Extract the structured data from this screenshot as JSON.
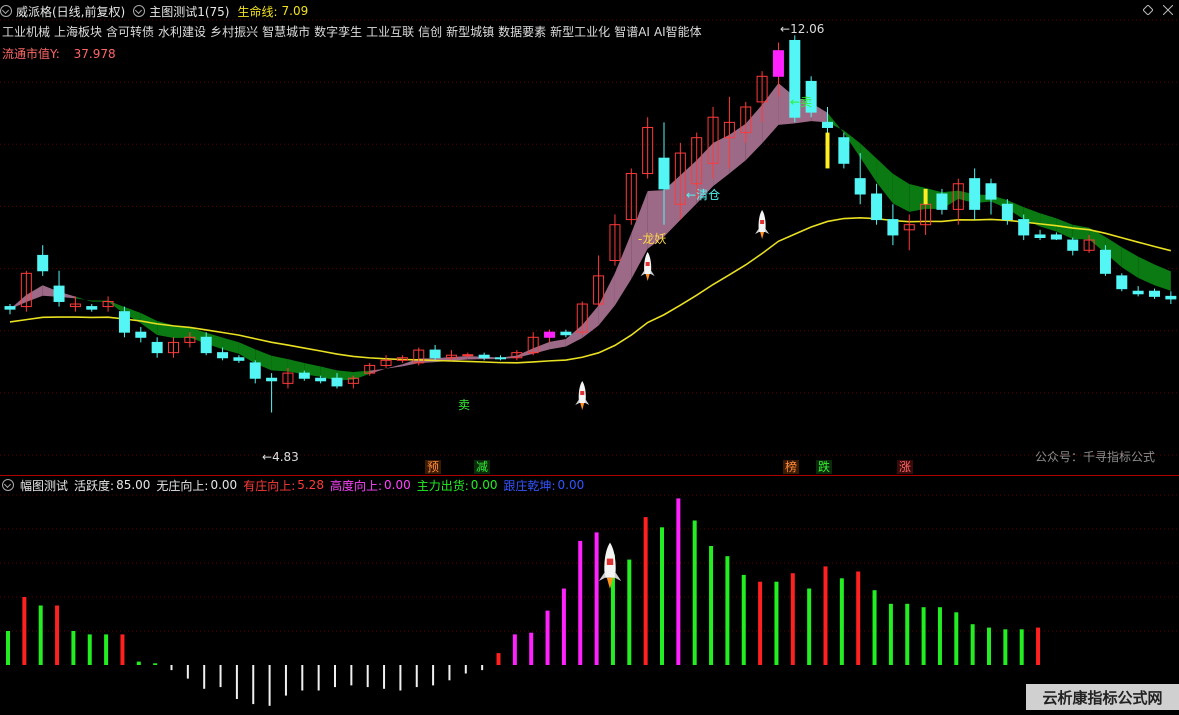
{
  "header": {
    "stock_name": "威派格(日线,前复权)",
    "indicator_name": "主图测试1(75)",
    "lifeline_label": "生命线:",
    "lifeline_value": "7.09"
  },
  "sectors": [
    "工业机械",
    "上海板块",
    "含可转债",
    "水利建设",
    "乡村振兴",
    "智慧城市",
    "数字孪生",
    "工业互联",
    "信创",
    "新型城镇",
    "数据要素",
    "新型工业化",
    "智谱AI",
    "AI智能体"
  ],
  "circulation": {
    "label": "流通市值Y:",
    "value": "37.978"
  },
  "annotations": {
    "high_price": "12.06",
    "low_price": "4.83",
    "sell_top": "卖",
    "sell_mid": "卖",
    "dragon": "龙妖",
    "clear": "清仓",
    "watermark": "公众号：千寻指标公式"
  },
  "signals": [
    {
      "label": "预",
      "color": "#ff8c3a",
      "bg": "#3a1a00"
    },
    {
      "label": "减",
      "color": "#33ee33",
      "bg": "#0a2a0a"
    },
    {
      "label": "榜",
      "color": "#ff8c3a",
      "bg": "#3a1a00"
    },
    {
      "label": "跌",
      "color": "#33ee33",
      "bg": "#0a2a0a"
    },
    {
      "label": "涨",
      "color": "#ff6666",
      "bg": "#3a0a0a"
    }
  ],
  "sub_header": {
    "title": "幅图测试",
    "activity_label": "活跃度:",
    "activity_value": "85.00",
    "no_dealer_label": "无庄向上:",
    "no_dealer_value": "0.00",
    "dealer_label": "有庄向上:",
    "dealer_value": "5.28",
    "control_label": "高度向上:",
    "control_value": "0.00",
    "main_ship_label": "主力出货:",
    "main_ship_value": "0.00",
    "follow_label": "跟庄乾坤:",
    "follow_value": "0.00"
  },
  "footer_brand": "云析康指标公式网",
  "colors": {
    "up": "#ff3a3a",
    "down": "#54f5f5",
    "ma_band_up": "#9c6a86",
    "ma_band_down": "#0c7a12",
    "lifeline": "#e8e020",
    "magenta": "#ff22ff",
    "green_bar": "#22ee22"
  },
  "chart_data": {
    "type": "candlestick",
    "ylim": [
      4.0,
      12.5
    ],
    "candles": [
      [
        6.9,
        6.95,
        6.75,
        6.85
      ],
      [
        6.9,
        7.6,
        6.8,
        7.55
      ],
      [
        7.9,
        8.1,
        7.5,
        7.6
      ],
      [
        7.3,
        7.6,
        6.9,
        7.0
      ],
      [
        6.9,
        7.1,
        6.8,
        6.95
      ],
      [
        6.9,
        6.95,
        6.8,
        6.85
      ],
      [
        6.9,
        7.1,
        6.8,
        7.0
      ],
      [
        6.8,
        6.9,
        6.3,
        6.4
      ],
      [
        6.4,
        6.5,
        6.2,
        6.3
      ],
      [
        6.2,
        6.3,
        5.9,
        6.0
      ],
      [
        6.0,
        6.3,
        5.9,
        6.2
      ],
      [
        6.2,
        6.4,
        6.1,
        6.3
      ],
      [
        6.3,
        6.4,
        5.95,
        6.0
      ],
      [
        6.0,
        6.1,
        5.85,
        5.9
      ],
      [
        5.9,
        5.95,
        5.8,
        5.85
      ],
      [
        5.8,
        5.85,
        5.4,
        5.5
      ],
      [
        5.5,
        5.6,
        4.83,
        5.45
      ],
      [
        5.4,
        5.7,
        5.3,
        5.6
      ],
      [
        5.6,
        5.65,
        5.45,
        5.5
      ],
      [
        5.5,
        5.55,
        5.4,
        5.45
      ],
      [
        5.5,
        5.6,
        5.3,
        5.35
      ],
      [
        5.4,
        5.55,
        5.3,
        5.5
      ],
      [
        5.6,
        5.8,
        5.55,
        5.75
      ],
      [
        5.75,
        5.95,
        5.7,
        5.85
      ],
      [
        5.85,
        5.95,
        5.8,
        5.9
      ],
      [
        5.8,
        6.1,
        5.75,
        6.05
      ],
      [
        6.05,
        6.15,
        5.85,
        5.9
      ],
      [
        5.9,
        6.05,
        5.85,
        5.95
      ],
      [
        5.95,
        6.0,
        5.9,
        5.96
      ],
      [
        5.95,
        6.0,
        5.85,
        5.9
      ],
      [
        5.9,
        5.95,
        5.85,
        5.88
      ],
      [
        5.9,
        6.05,
        5.85,
        6.0
      ],
      [
        6.0,
        6.4,
        5.95,
        6.3
      ],
      [
        6.3,
        6.45,
        6.2,
        6.4
      ],
      [
        6.4,
        6.45,
        6.3,
        6.35
      ],
      [
        6.4,
        7.0,
        6.35,
        6.95
      ],
      [
        6.95,
        7.9,
        6.9,
        7.5
      ],
      [
        7.8,
        8.7,
        7.7,
        8.5
      ],
      [
        8.6,
        9.6,
        8.5,
        9.5
      ],
      [
        9.5,
        10.6,
        9.4,
        10.4
      ],
      [
        9.8,
        10.5,
        8.5,
        9.2
      ],
      [
        8.9,
        10.1,
        8.6,
        9.9
      ],
      [
        9.3,
        10.3,
        9.0,
        10.2
      ],
      [
        9.7,
        10.8,
        9.4,
        10.6
      ],
      [
        10.2,
        11.0,
        9.6,
        10.5
      ],
      [
        10.3,
        10.9,
        10.1,
        10.8
      ],
      [
        10.9,
        11.5,
        10.5,
        11.4
      ],
      [
        11.4,
        12.06,
        11.0,
        11.9
      ],
      [
        12.1,
        12.2,
        10.5,
        10.6
      ],
      [
        11.3,
        11.4,
        10.6,
        10.7
      ],
      [
        10.5,
        10.8,
        10.2,
        10.4
      ],
      [
        10.2,
        10.3,
        9.6,
        9.7
      ],
      [
        9.4,
        9.9,
        8.9,
        9.1
      ],
      [
        9.1,
        9.3,
        8.5,
        8.6
      ],
      [
        8.6,
        8.9,
        8.1,
        8.3
      ],
      [
        8.4,
        8.7,
        8.0,
        8.5
      ],
      [
        8.5,
        9.0,
        8.3,
        8.9
      ],
      [
        9.1,
        9.2,
        8.7,
        8.8
      ],
      [
        8.8,
        9.4,
        8.5,
        9.3
      ],
      [
        9.4,
        9.6,
        8.6,
        8.8
      ],
      [
        9.3,
        9.4,
        8.7,
        9.0
      ],
      [
        8.9,
        9.0,
        8.5,
        8.6
      ],
      [
        8.6,
        8.7,
        8.2,
        8.3
      ],
      [
        8.3,
        8.4,
        8.2,
        8.25
      ],
      [
        8.3,
        8.35,
        8.2,
        8.22
      ],
      [
        8.2,
        8.25,
        7.9,
        8.0
      ],
      [
        8.0,
        8.3,
        7.95,
        8.2
      ],
      [
        8.0,
        8.1,
        7.5,
        7.55
      ],
      [
        7.5,
        7.55,
        7.2,
        7.25
      ],
      [
        7.2,
        7.3,
        7.1,
        7.15
      ],
      [
        7.2,
        7.25,
        7.05,
        7.1
      ],
      [
        7.1,
        7.2,
        6.95,
        7.05
      ]
    ],
    "histogram": [
      {
        "v": 20,
        "c": "g"
      },
      {
        "v": 40,
        "c": "r"
      },
      {
        "v": 35,
        "c": "g"
      },
      {
        "v": 35,
        "c": "r"
      },
      {
        "v": 20,
        "c": "g"
      },
      {
        "v": 18,
        "c": "g"
      },
      {
        "v": 18,
        "c": "g"
      },
      {
        "v": 18,
        "c": "r"
      },
      {
        "v": 2,
        "c": "g"
      },
      {
        "v": 1,
        "c": "g"
      },
      {
        "v": -3,
        "c": "w"
      },
      {
        "v": -8,
        "c": "w"
      },
      {
        "v": -14,
        "c": "w"
      },
      {
        "v": -13,
        "c": "w"
      },
      {
        "v": -20,
        "c": "w"
      },
      {
        "v": -23,
        "c": "w"
      },
      {
        "v": -24,
        "c": "w"
      },
      {
        "v": -18,
        "c": "w"
      },
      {
        "v": -15,
        "c": "w"
      },
      {
        "v": -15,
        "c": "w"
      },
      {
        "v": -13,
        "c": "w"
      },
      {
        "v": -12,
        "c": "w"
      },
      {
        "v": -13,
        "c": "w"
      },
      {
        "v": -14,
        "c": "w"
      },
      {
        "v": -15,
        "c": "w"
      },
      {
        "v": -13,
        "c": "w"
      },
      {
        "v": -12,
        "c": "w"
      },
      {
        "v": -9,
        "c": "w"
      },
      {
        "v": -5,
        "c": "w"
      },
      {
        "v": -3,
        "c": "w"
      },
      {
        "v": 7,
        "c": "r"
      },
      {
        "v": 18,
        "c": "m"
      },
      {
        "v": 19,
        "c": "m"
      },
      {
        "v": 32,
        "c": "m"
      },
      {
        "v": 45,
        "c": "m"
      },
      {
        "v": 73,
        "c": "m"
      },
      {
        "v": 78,
        "c": "m"
      },
      {
        "v": 65,
        "c": "g"
      },
      {
        "v": 62,
        "c": "g"
      },
      {
        "v": 87,
        "c": "r"
      },
      {
        "v": 81,
        "c": "g"
      },
      {
        "v": 98,
        "c": "m"
      },
      {
        "v": 85,
        "c": "g"
      },
      {
        "v": 70,
        "c": "g"
      },
      {
        "v": 64,
        "c": "g"
      },
      {
        "v": 53,
        "c": "g"
      },
      {
        "v": 49,
        "c": "r"
      },
      {
        "v": 49,
        "c": "g"
      },
      {
        "v": 54,
        "c": "r"
      },
      {
        "v": 45,
        "c": "g"
      },
      {
        "v": 58,
        "c": "r"
      },
      {
        "v": 51,
        "c": "g"
      },
      {
        "v": 55,
        "c": "r"
      },
      {
        "v": 44,
        "c": "g"
      },
      {
        "v": 36,
        "c": "g"
      },
      {
        "v": 36,
        "c": "g"
      },
      {
        "v": 34,
        "c": "g"
      },
      {
        "v": 34,
        "c": "g"
      },
      {
        "v": 31,
        "c": "g"
      },
      {
        "v": 24,
        "c": "g"
      },
      {
        "v": 22,
        "c": "g"
      },
      {
        "v": 21,
        "c": "g"
      },
      {
        "v": 21,
        "c": "g"
      },
      {
        "v": 22,
        "c": "r"
      }
    ]
  }
}
